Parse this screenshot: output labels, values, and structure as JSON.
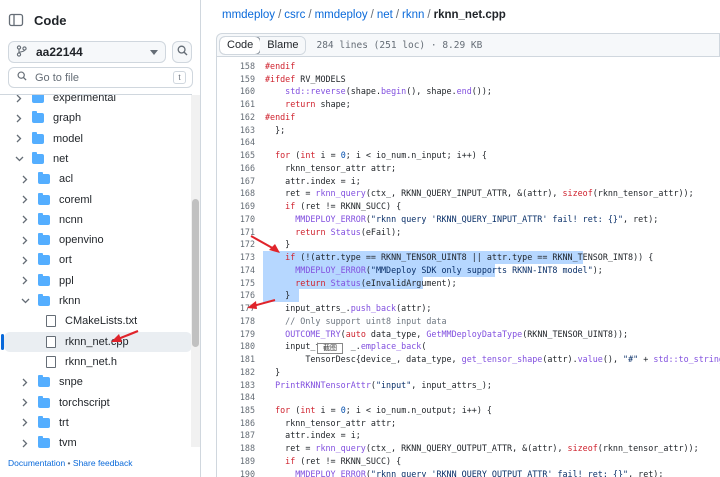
{
  "sidebar": {
    "title": "Code",
    "branch": "aa22144",
    "goto_placeholder": "Go to file",
    "goto_shortcut": "t",
    "items": [
      {
        "label": "experimental",
        "type": "folder",
        "indent": 1,
        "expanded": false
      },
      {
        "label": "graph",
        "type": "folder",
        "indent": 1,
        "expanded": false
      },
      {
        "label": "model",
        "type": "folder",
        "indent": 1,
        "expanded": false
      },
      {
        "label": "net",
        "type": "folder",
        "indent": 1,
        "expanded": true
      },
      {
        "label": "acl",
        "type": "folder",
        "indent": 2,
        "expanded": false
      },
      {
        "label": "coreml",
        "type": "folder",
        "indent": 2,
        "expanded": false
      },
      {
        "label": "ncnn",
        "type": "folder",
        "indent": 2,
        "expanded": false
      },
      {
        "label": "openvino",
        "type": "folder",
        "indent": 2,
        "expanded": false
      },
      {
        "label": "ort",
        "type": "folder",
        "indent": 2,
        "expanded": false
      },
      {
        "label": "ppl",
        "type": "folder",
        "indent": 2,
        "expanded": false
      },
      {
        "label": "rknn",
        "type": "folder",
        "indent": 2,
        "expanded": true
      },
      {
        "label": "CMakeLists.txt",
        "type": "file",
        "indent": 3
      },
      {
        "label": "rknn_net.cpp",
        "type": "file",
        "indent": 3,
        "selected": true
      },
      {
        "label": "rknn_net.h",
        "type": "file",
        "indent": 3
      },
      {
        "label": "snpe",
        "type": "folder",
        "indent": 2,
        "expanded": false
      },
      {
        "label": "torchscript",
        "type": "folder",
        "indent": 2,
        "expanded": false
      },
      {
        "label": "trt",
        "type": "folder",
        "indent": 2,
        "expanded": false
      },
      {
        "label": "tvm",
        "type": "folder",
        "indent": 2,
        "expanded": false
      }
    ],
    "footer_doc": "Documentation",
    "footer_sep": "•",
    "footer_feedback": "Share feedback"
  },
  "breadcrumb": {
    "parts": [
      "mmdeploy",
      "csrc",
      "mmdeploy",
      "net",
      "rknn"
    ],
    "current": "rknn_net.cpp"
  },
  "codebar": {
    "code_tab": "Code",
    "blame_tab": "Blame",
    "meta": "284 lines (251 loc) · 8.29 KB"
  },
  "code_lines": [
    {
      "n": "158",
      "html": "<span class=\"k\">#endif</span>"
    },
    {
      "n": "159",
      "html": "<span class=\"k\">#ifdef</span> RV_MODELS"
    },
    {
      "n": "160",
      "html": "    <span class=\"f\">std::reverse</span>(shape.<span class=\"f\">begin</span>(), shape.<span class=\"f\">end</span>());"
    },
    {
      "n": "161",
      "html": "    <span class=\"k\">return</span> shape;"
    },
    {
      "n": "162",
      "html": "<span class=\"k\">#endif</span>"
    },
    {
      "n": "163",
      "html": "  };"
    },
    {
      "n": "164",
      "html": ""
    },
    {
      "n": "165",
      "html": "  <span class=\"k\">for</span> (<span class=\"k\">int</span> i = <span class=\"p\">0</span>; i &lt; io_num.n_input; i++) {"
    },
    {
      "n": "166",
      "html": "    rknn_tensor_attr attr;"
    },
    {
      "n": "167",
      "html": "    attr.index = i;"
    },
    {
      "n": "168",
      "html": "    ret = <span class=\"f\">rknn_query</span>(ctx_, RKNN_QUERY_INPUT_ATTR, &amp;(attr), <span class=\"k\">sizeof</span>(rknn_tensor_attr));"
    },
    {
      "n": "169",
      "html": "    <span class=\"k\">if</span> (ret != RKNN_SUCC) {"
    },
    {
      "n": "170",
      "html": "      <span class=\"f\">MMDEPLOY_ERROR</span>(<span class=\"s\">\"rknn query 'RKNN_QUERY_INPUT_ATTR' fail! ret: {}\"</span>, ret);"
    },
    {
      "n": "171",
      "html": "      <span class=\"k\">return</span> <span class=\"f\">Status</span>(eFail);"
    },
    {
      "n": "172",
      "html": "    }"
    },
    {
      "n": "173",
      "html": "    <span class=\"k\">if</span> (!(attr.type == RKNN_TENSOR_UINT8 || attr.type == RKNN_TENSOR_INT8)) {",
      "hl": true
    },
    {
      "n": "174",
      "html": "      <span class=\"f\">MMDEPLOY_ERROR</span>(<span class=\"s\">\"MMDeploy SDK only supports RKNN-INT8 model\"</span>);",
      "hl": true
    },
    {
      "n": "175",
      "html": "      <span class=\"k\">return</span> <span class=\"f\">Status</span>(eInvalidArgument);",
      "hl": true
    },
    {
      "n": "176",
      "html": "    }",
      "hl": true
    },
    {
      "n": "177",
      "html": "    input_attrs_.<span class=\"f\">push_back</span>(attr);"
    },
    {
      "n": "178",
      "html": "    <span class=\"c\">// Only support uint8 input data</span>"
    },
    {
      "n": "179",
      "html": "    <span class=\"f\">OUTCOME_TRY</span>(<span class=\"k\">auto</span> data_type, <span class=\"f\">GetMMDeployDataType</span>(RKNN_TENSOR_UINT8));"
    },
    {
      "n": "180",
      "html": "    input_te     _.<span class=\"f\">emplace_back</span>("
    },
    {
      "n": "181",
      "html": "        TensorDesc{device_, data_type, <span class=\"f\">get_tensor_shape</span>(attr).<span class=\"f\">value</span>(), <span class=\"s\">\"#\"</span> + <span class=\"f\">std::to_string</span>(i)});"
    },
    {
      "n": "182",
      "html": "  }"
    },
    {
      "n": "183",
      "html": "  <span class=\"f\">PrintRKNNTensorAttr</span>(<span class=\"s\">\"input\"</span>, input_attrs_);"
    },
    {
      "n": "184",
      "html": ""
    },
    {
      "n": "185",
      "html": "  <span class=\"k\">for</span> (<span class=\"k\">int</span> i = <span class=\"p\">0</span>; i &lt; io_num.n_output; i++) {"
    },
    {
      "n": "186",
      "html": "    rknn_tensor_attr attr;"
    },
    {
      "n": "187",
      "html": "    attr.index = i;"
    },
    {
      "n": "188",
      "html": "    ret = <span class=\"f\">rknn_query</span>(ctx_, RKNN_QUERY_OUTPUT_ATTR, &amp;(attr), <span class=\"k\">sizeof</span>(rknn_tensor_attr));"
    },
    {
      "n": "189",
      "html": "    <span class=\"k\">if</span> (ret != RKNN_SUCC) {"
    },
    {
      "n": "190",
      "html": "      <span class=\"f\">MMDEPLOY_ERROR</span>(<span class=\"s\">\"rknn query 'RKNN_QUERY_OUTPUT_ATTR' fail! ret: {}\"</span>, ret);"
    }
  ],
  "watermark_text": "截图",
  "colors": {
    "accent": "#0969da",
    "highlight": "#b6d7ff",
    "annotation_arrow": "#e0242b"
  }
}
